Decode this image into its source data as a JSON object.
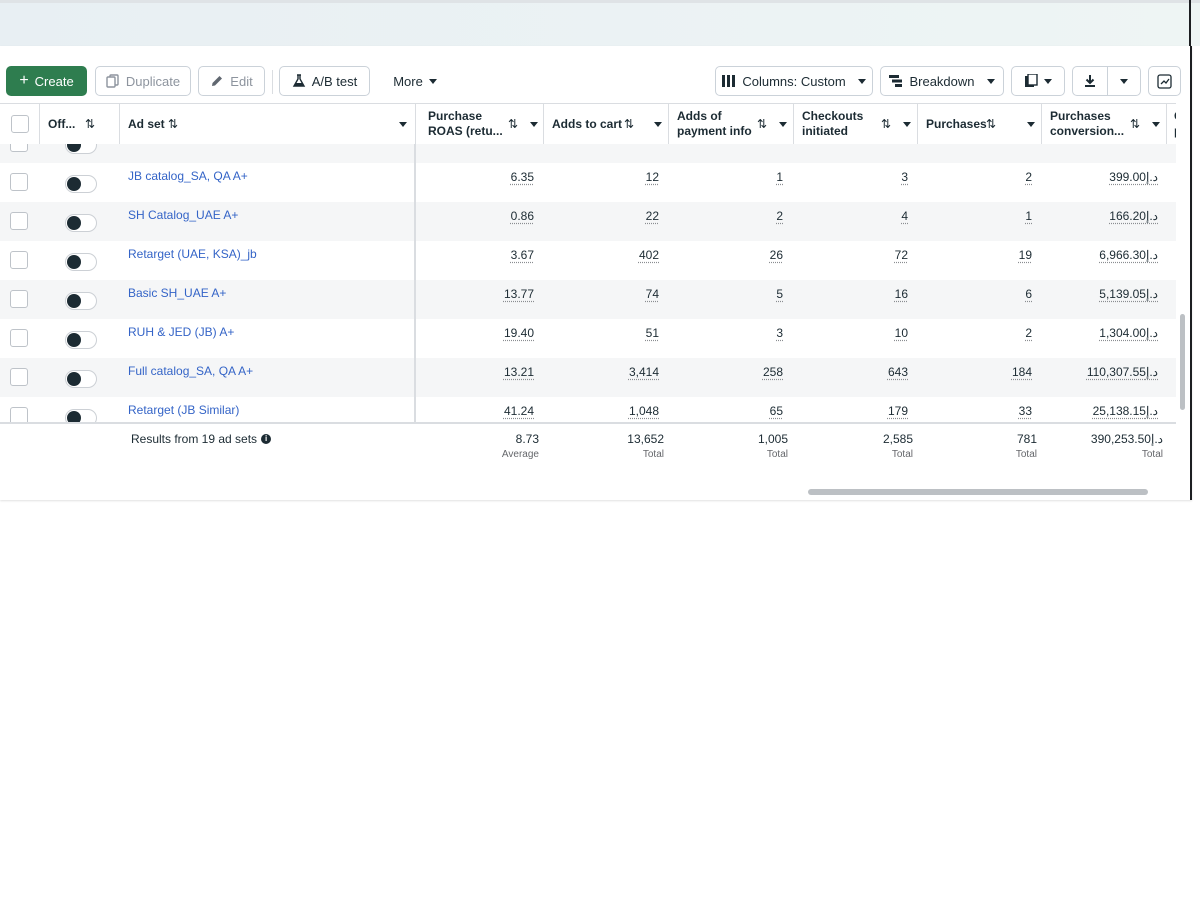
{
  "toolbar": {
    "create": "Create",
    "duplicate": "Duplicate",
    "edit": "Edit",
    "ab_test": "A/B test",
    "more": "More",
    "columns": "Columns: Custom",
    "breakdown": "Breakdown"
  },
  "columns": {
    "off": "Off...",
    "ad_set": "Ad set",
    "roas_1": "Purchase",
    "roas_2": "ROAS (retu...",
    "adds_to_cart": "Adds to cart",
    "payment_1": "Adds of",
    "payment_2": "payment info",
    "checkouts_1": "Checkouts",
    "checkouts_2": "initiated",
    "purchases": "Purchases",
    "conv_1": "Purchases",
    "conv_2": "conversion...",
    "cut_1": "Co",
    "cut_2": "pu"
  },
  "rows": [
    {
      "name": "JB catalog_SA, QA A+",
      "roas": "6.35",
      "cart": "12",
      "payment": "1",
      "checkouts": "3",
      "purchases": "2",
      "value": "399.00د.إ"
    },
    {
      "name": "SH Catalog_UAE A+",
      "roas": "0.86",
      "cart": "22",
      "payment": "2",
      "checkouts": "4",
      "purchases": "1",
      "value": "166.20د.إ"
    },
    {
      "name": "Retarget (UAE, KSA)_jb",
      "roas": "3.67",
      "cart": "402",
      "payment": "26",
      "checkouts": "72",
      "purchases": "19",
      "value": "6,966.30د.إ"
    },
    {
      "name": "Basic SH_UAE A+",
      "roas": "13.77",
      "cart": "74",
      "payment": "5",
      "checkouts": "16",
      "purchases": "6",
      "value": "5,139.05د.إ"
    },
    {
      "name": "RUH & JED (JB) A+",
      "roas": "19.40",
      "cart": "51",
      "payment": "3",
      "checkouts": "10",
      "purchases": "2",
      "value": "1,304.00د.إ"
    },
    {
      "name": "Full catalog_SA, QA A+",
      "roas": "13.21",
      "cart": "3,414",
      "payment": "258",
      "checkouts": "643",
      "purchases": "184",
      "value": "110,307.55د.إ"
    },
    {
      "name": "Retarget (JB Similar)",
      "roas": "41.24",
      "cart": "1,048",
      "payment": "65",
      "checkouts": "179",
      "purchases": "33",
      "value": "25,138.15د.إ"
    }
  ],
  "footer": {
    "results": "Results from 19 ad sets",
    "roas": "8.73",
    "roas_sub": "Average",
    "cart": "13,652",
    "cart_sub": "Total",
    "payment": "1,005",
    "payment_sub": "Total",
    "checkouts": "2,585",
    "checkouts_sub": "Total",
    "purchases": "781",
    "purchases_sub": "Total",
    "value": "390,253.50د.إ",
    "value_sub": "Total"
  },
  "colors": {
    "create_green": "#2e7d4f",
    "link_blue": "#3464c7",
    "text": "#1c2b33"
  },
  "icons": [
    "plus-icon",
    "duplicate-icon",
    "pencil-icon",
    "flask-icon",
    "columns-icon",
    "breakdown-icon",
    "reports-icon",
    "download-icon",
    "chart-icon",
    "sort-icon",
    "info-icon"
  ]
}
